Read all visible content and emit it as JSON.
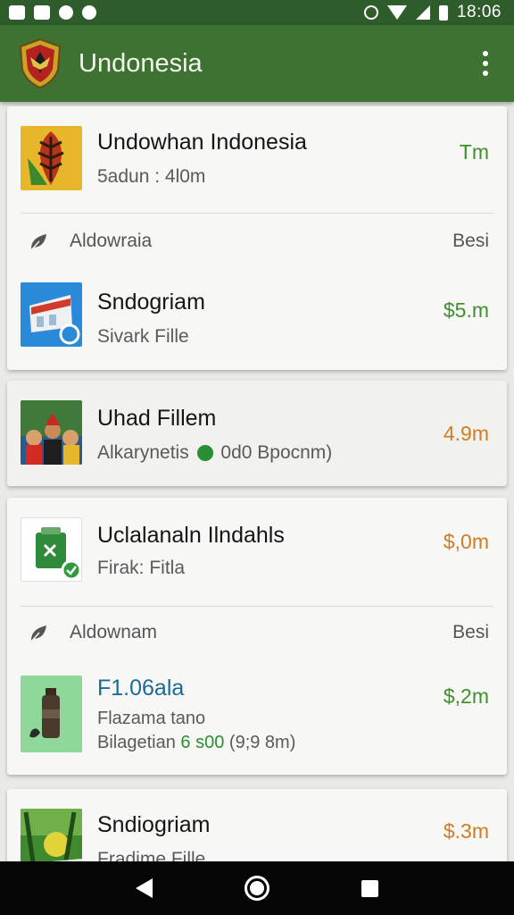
{
  "status_bar": {
    "time": "18:06",
    "left_icons": [
      "image-icon",
      "photo-icon",
      "notification-icon",
      "whatsapp-icon"
    ],
    "right_icons": [
      "alarm-icon",
      "wifi-icon",
      "signal-icon",
      "battery-icon"
    ]
  },
  "app_bar": {
    "title": "Undonesia",
    "logo": "garuda-emblem-icon",
    "menu_icon": "overflow-menu-icon"
  },
  "cards": [
    {
      "rows": [
        {
          "title": "Undowhan Indonesia",
          "sub": "5adun : 4l0m",
          "price": "Tm",
          "price_color": "green",
          "thumb": "leaf-emblem-icon"
        }
      ],
      "section": {
        "label": "Aldowraia",
        "right": "Besi",
        "icon": "leaf-icon"
      },
      "rows2": [
        {
          "title": "Sndogriam",
          "sub": "Sivark Fille",
          "price": "$5.m",
          "price_color": "green",
          "thumb": "building-app-icon"
        }
      ]
    },
    {
      "rows": [
        {
          "title": "Uhad Fillem",
          "sub_prefix": "Alkarynetis",
          "sub_suffix": "0d0 Bpocnm)",
          "price": "4.9m",
          "price_color": "orange",
          "thumb": "crowd-photo-icon"
        }
      ]
    },
    {
      "rows": [
        {
          "title": "Uclalanaln Ilndahls",
          "sub": "Firak: Fitla",
          "price": "$,0m",
          "price_color": "orange",
          "thumb": "spreadsheet-app-icon"
        }
      ],
      "section": {
        "label": "Aldownam",
        "right": "Besi",
        "icon": "leaf-icon"
      },
      "rows2": [
        {
          "title": "F1.06ala",
          "sub1": "Flazama tano",
          "sub2_prefix": "Bilagetian",
          "sub2_highlight": "6 s00",
          "sub2_suffix": "(9;9 8m)",
          "price": "$,2m",
          "price_color": "green",
          "thumb": "bottle-product-icon"
        }
      ]
    },
    {
      "rows": [
        {
          "title": "Sndiogriam",
          "sub": "Fradime Fille",
          "price": "$.3m",
          "price_color": "orange",
          "thumb": "nature-photo-icon"
        }
      ]
    }
  ],
  "nav_bar": {
    "back": "back-icon",
    "home": "home-icon",
    "recent": "recent-apps-icon"
  }
}
